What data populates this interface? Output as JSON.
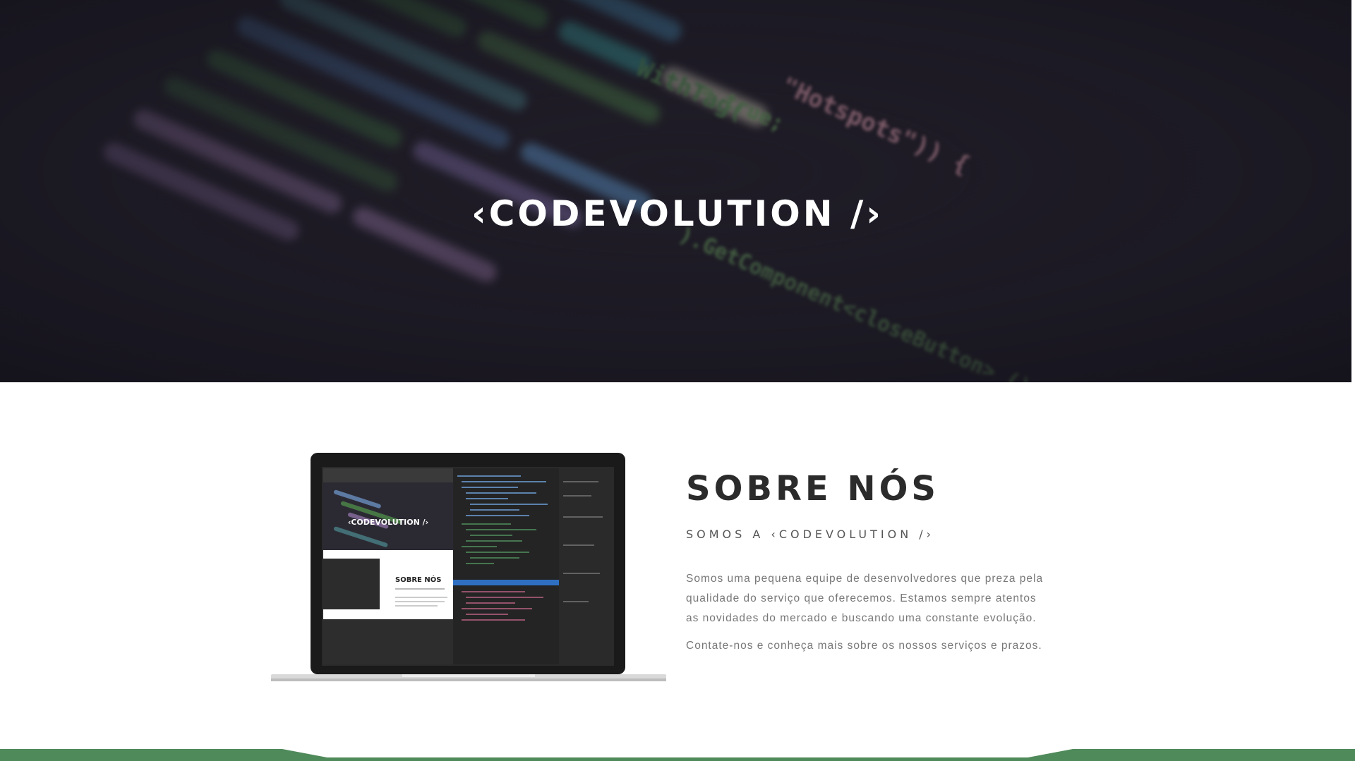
{
  "hero": {
    "title": "‹CODEVOLUTION /›"
  },
  "about": {
    "heading": "SOBRE NÓS",
    "subheading": "SOMOS A ‹CODEVOLUTION /›",
    "paragraph1": "Somos uma pequena equipe de desenvolvedores que preza pela qualidade do serviço que oferecemos. Estamos sempre atentos as novidades do mercado e buscando uma constante evolução.",
    "paragraph2": "Contate-nos e conheça mais sobre os nossos serviços e prazos."
  },
  "laptop_screen": {
    "title": "‹CODEVOLUTION /›",
    "heading": "SOBRE NÓS"
  },
  "colors": {
    "hero_bg": "#1d1b23",
    "accent_green": "#4f8a5a",
    "heading": "#2b2b2b",
    "body_text": "#777777"
  }
}
